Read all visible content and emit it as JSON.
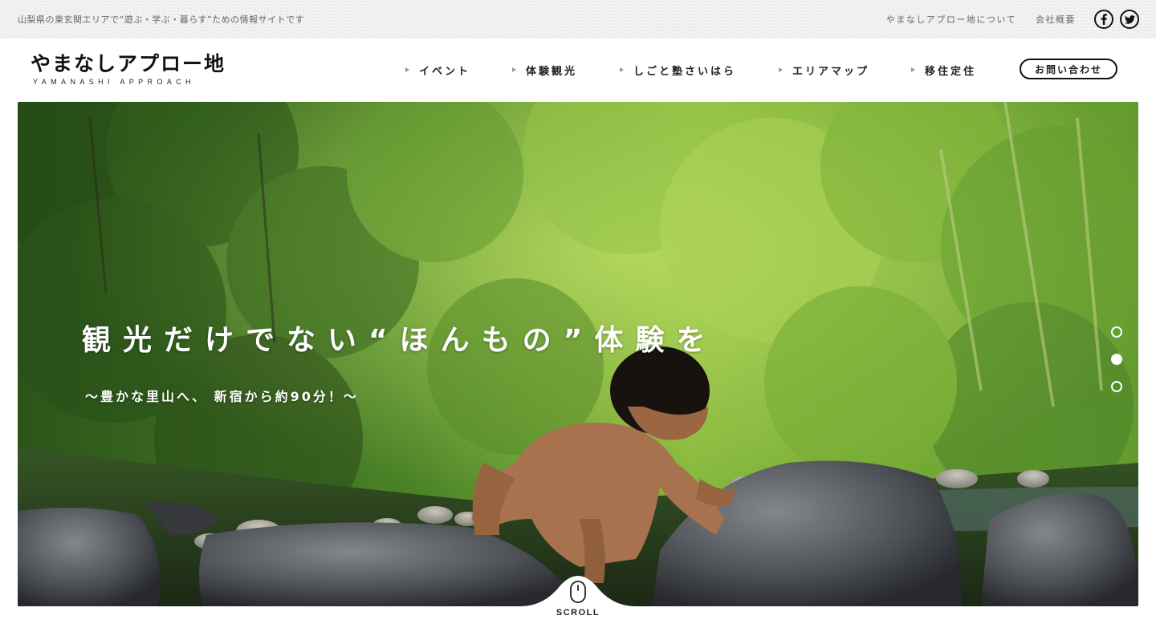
{
  "topbar": {
    "tagline": "山梨県の東玄関エリアで“遊ぶ・学ぶ・暮らす”ための情報サイトです",
    "links": [
      "やまなしアプロー地について",
      "会社概要"
    ],
    "social": [
      {
        "name": "facebook",
        "icon": "facebook-icon"
      },
      {
        "name": "twitter",
        "icon": "twitter-icon"
      }
    ]
  },
  "header": {
    "logo": "やまなしアプロー地",
    "logo_sub": "YAMANASHI APPROACH",
    "nav": [
      "イベント",
      "体験観光",
      "しごと塾さいはら",
      "エリアマップ",
      "移住定住"
    ],
    "contact": "お問い合わせ"
  },
  "hero": {
    "title": "観光だけでない“ほんもの”体験を",
    "subtitle": "〜豊かな里山へ、 新宿から約90分！〜",
    "slides": 3,
    "active_slide": 2
  },
  "scroll": {
    "label": "SCROLL",
    "icon": "mouse-icon"
  },
  "colors": {
    "text": "#222222",
    "topbar_bg": "#f2f2f2",
    "hero_green": "#3d6b24"
  }
}
